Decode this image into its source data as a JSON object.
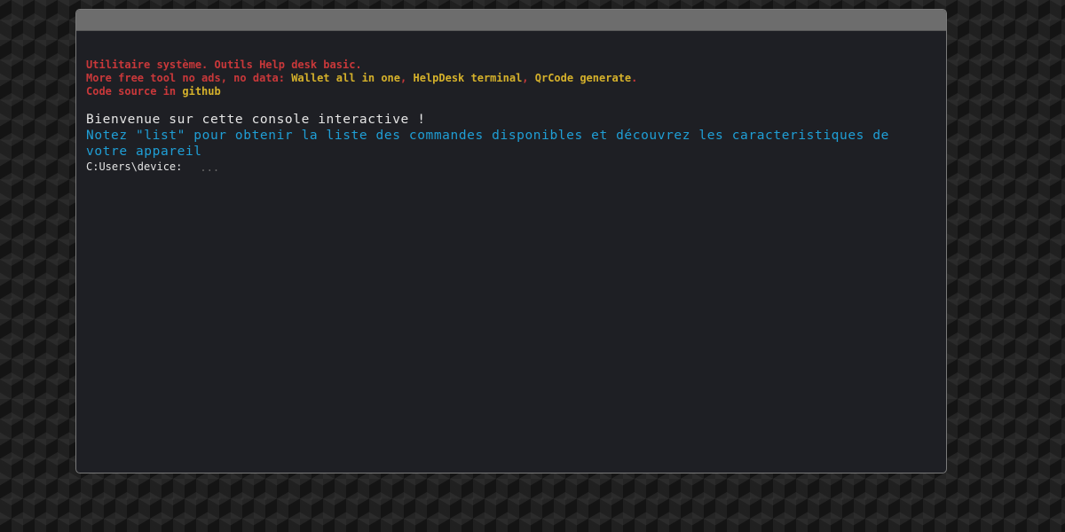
{
  "info": {
    "line1": "Utilitaire système. Outils Help desk basic.",
    "line2_prefix": "More free tool no ads, no data: ",
    "line2_links": [
      "Wallet all in one",
      "HelpDesk terminal",
      "QrCode generate"
    ],
    "line2_sep": ", ",
    "line2_suffix": ".",
    "line3_prefix": "Code source in ",
    "line3_link": "github"
  },
  "console": {
    "welcome": "Bienvenue sur cette console interactive !",
    "hint": "Notez \"list\" pour obtenir la liste des commandes disponibles et découvrez les caracteristiques de votre appareil",
    "prompt": "C:Users\\device:",
    "input_placeholder": "..."
  },
  "colors": {
    "background": "#141414",
    "window": "#1e1f24",
    "title_bar": "#6d6d6d",
    "info_red": "#c9383a",
    "link_yellow": "#d5b12b",
    "welcome_text": "#e6e6e6",
    "hint_blue": "#1f9fd6"
  }
}
